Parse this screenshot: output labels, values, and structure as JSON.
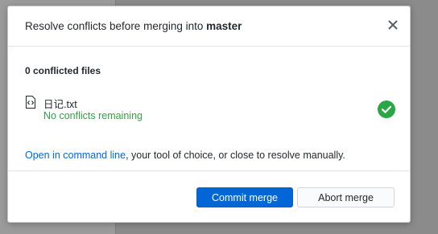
{
  "dialog": {
    "title_prefix": "Resolve conflicts before merging into ",
    "branch": "master",
    "close_icon": "close-icon"
  },
  "conflicts": {
    "count_label": "0 conflicted files",
    "files": [
      {
        "name": "日记.txt",
        "status": "No conflicts remaining",
        "file_icon": "file-code-icon",
        "status_icon": "check-circle-icon"
      }
    ]
  },
  "info": {
    "link_text": "Open in command line",
    "rest_text": ", your tool of choice, or close to resolve manually."
  },
  "footer": {
    "commit_label": "Commit merge",
    "abort_label": "Abort merge"
  },
  "colors": {
    "accent": "#0366d6",
    "success": "#28a745",
    "text": "#24292e"
  }
}
